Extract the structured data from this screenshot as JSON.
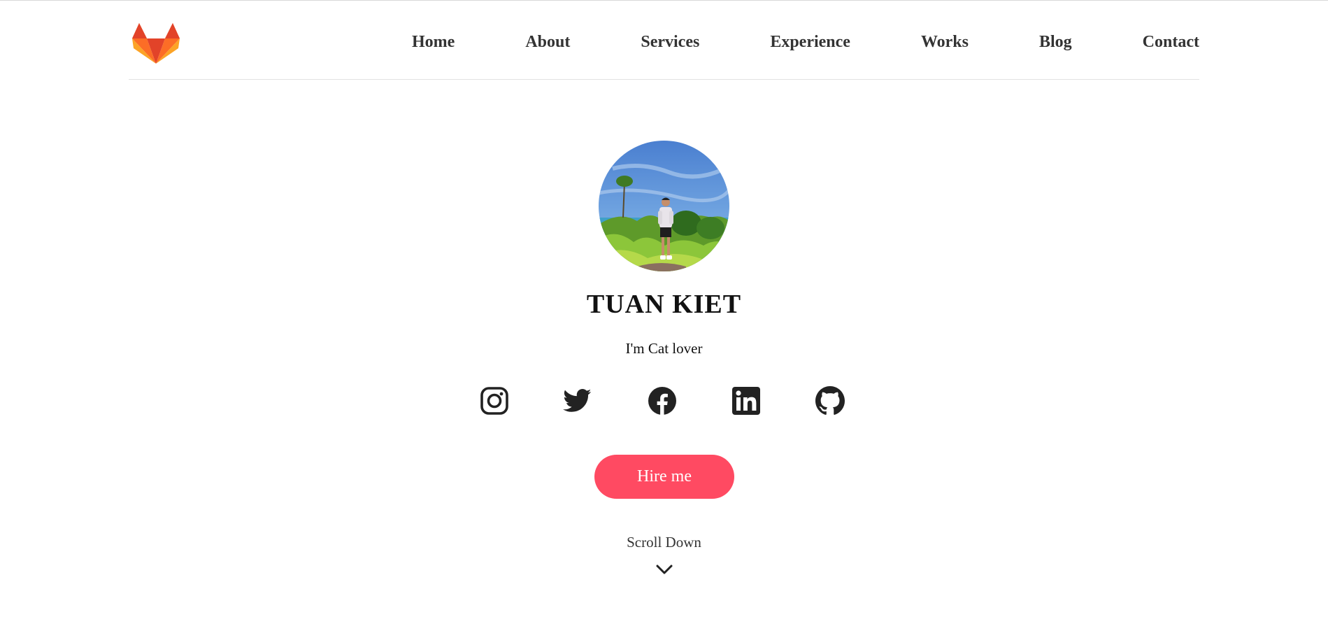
{
  "header": {
    "logo": "gitlab-fox-logo",
    "nav": [
      "Home",
      "About",
      "Services",
      "Experience",
      "Works",
      "Blog",
      "Contact"
    ]
  },
  "hero": {
    "avatar": "profile-photo",
    "name": "TUAN KIET",
    "subtitle": "I'm Cat lover",
    "socials": [
      "instagram-icon",
      "twitter-icon",
      "facebook-icon",
      "linkedin-icon",
      "github-icon"
    ],
    "hire_label": "Hire me",
    "scroll_label": "Scroll Down",
    "scroll_icon": "chevron-down-icon"
  },
  "colors": {
    "accent": "#ff4a62",
    "text": "#333333",
    "icon": "#222222",
    "logo_red": "#e24329",
    "logo_orange": "#fc6d26",
    "logo_yellow": "#fca326"
  }
}
